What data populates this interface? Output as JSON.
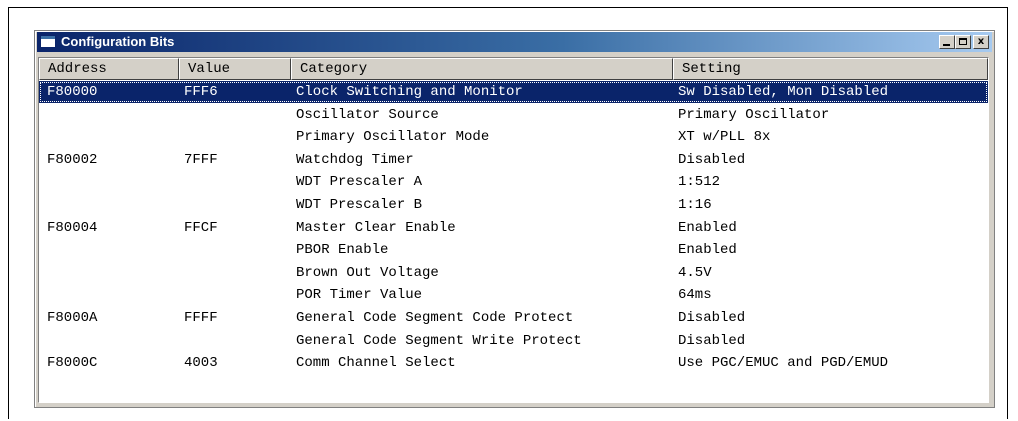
{
  "window": {
    "title": "Configuration Bits",
    "controls": {
      "minimize": "_",
      "maximize": "□",
      "close": "x"
    }
  },
  "table": {
    "columns": [
      "Address",
      "Value",
      "Category",
      "Setting"
    ],
    "rows": [
      {
        "address": "F80000",
        "value": "FFF6",
        "category": "Clock Switching and Monitor",
        "setting": "Sw Disabled, Mon Disabled",
        "selected": true
      },
      {
        "address": "",
        "value": "",
        "category": "Oscillator Source",
        "setting": "Primary Oscillator"
      },
      {
        "address": "",
        "value": "",
        "category": "Primary Oscillator Mode",
        "setting": "XT w/PLL 8x"
      },
      {
        "address": "F80002",
        "value": "7FFF",
        "category": "Watchdog Timer",
        "setting": "Disabled"
      },
      {
        "address": "",
        "value": "",
        "category": "WDT Prescaler A",
        "setting": "1:512"
      },
      {
        "address": "",
        "value": "",
        "category": "WDT Prescaler B",
        "setting": "1:16"
      },
      {
        "address": "F80004",
        "value": "FFCF",
        "category": "Master Clear Enable",
        "setting": "Enabled"
      },
      {
        "address": "",
        "value": "",
        "category": "PBOR Enable",
        "setting": "Enabled"
      },
      {
        "address": "",
        "value": "",
        "category": "Brown Out Voltage",
        "setting": "4.5V"
      },
      {
        "address": "",
        "value": "",
        "category": "POR Timer Value",
        "setting": "64ms"
      },
      {
        "address": "F8000A",
        "value": "FFFF",
        "category": "General Code Segment Code Protect",
        "setting": "Disabled"
      },
      {
        "address": "",
        "value": "",
        "category": "General Code Segment Write Protect",
        "setting": "Disabled"
      },
      {
        "address": "F8000C",
        "value": "4003",
        "category": "Comm Channel Select",
        "setting": "Use PGC/EMUC and PGD/EMUD"
      }
    ]
  }
}
